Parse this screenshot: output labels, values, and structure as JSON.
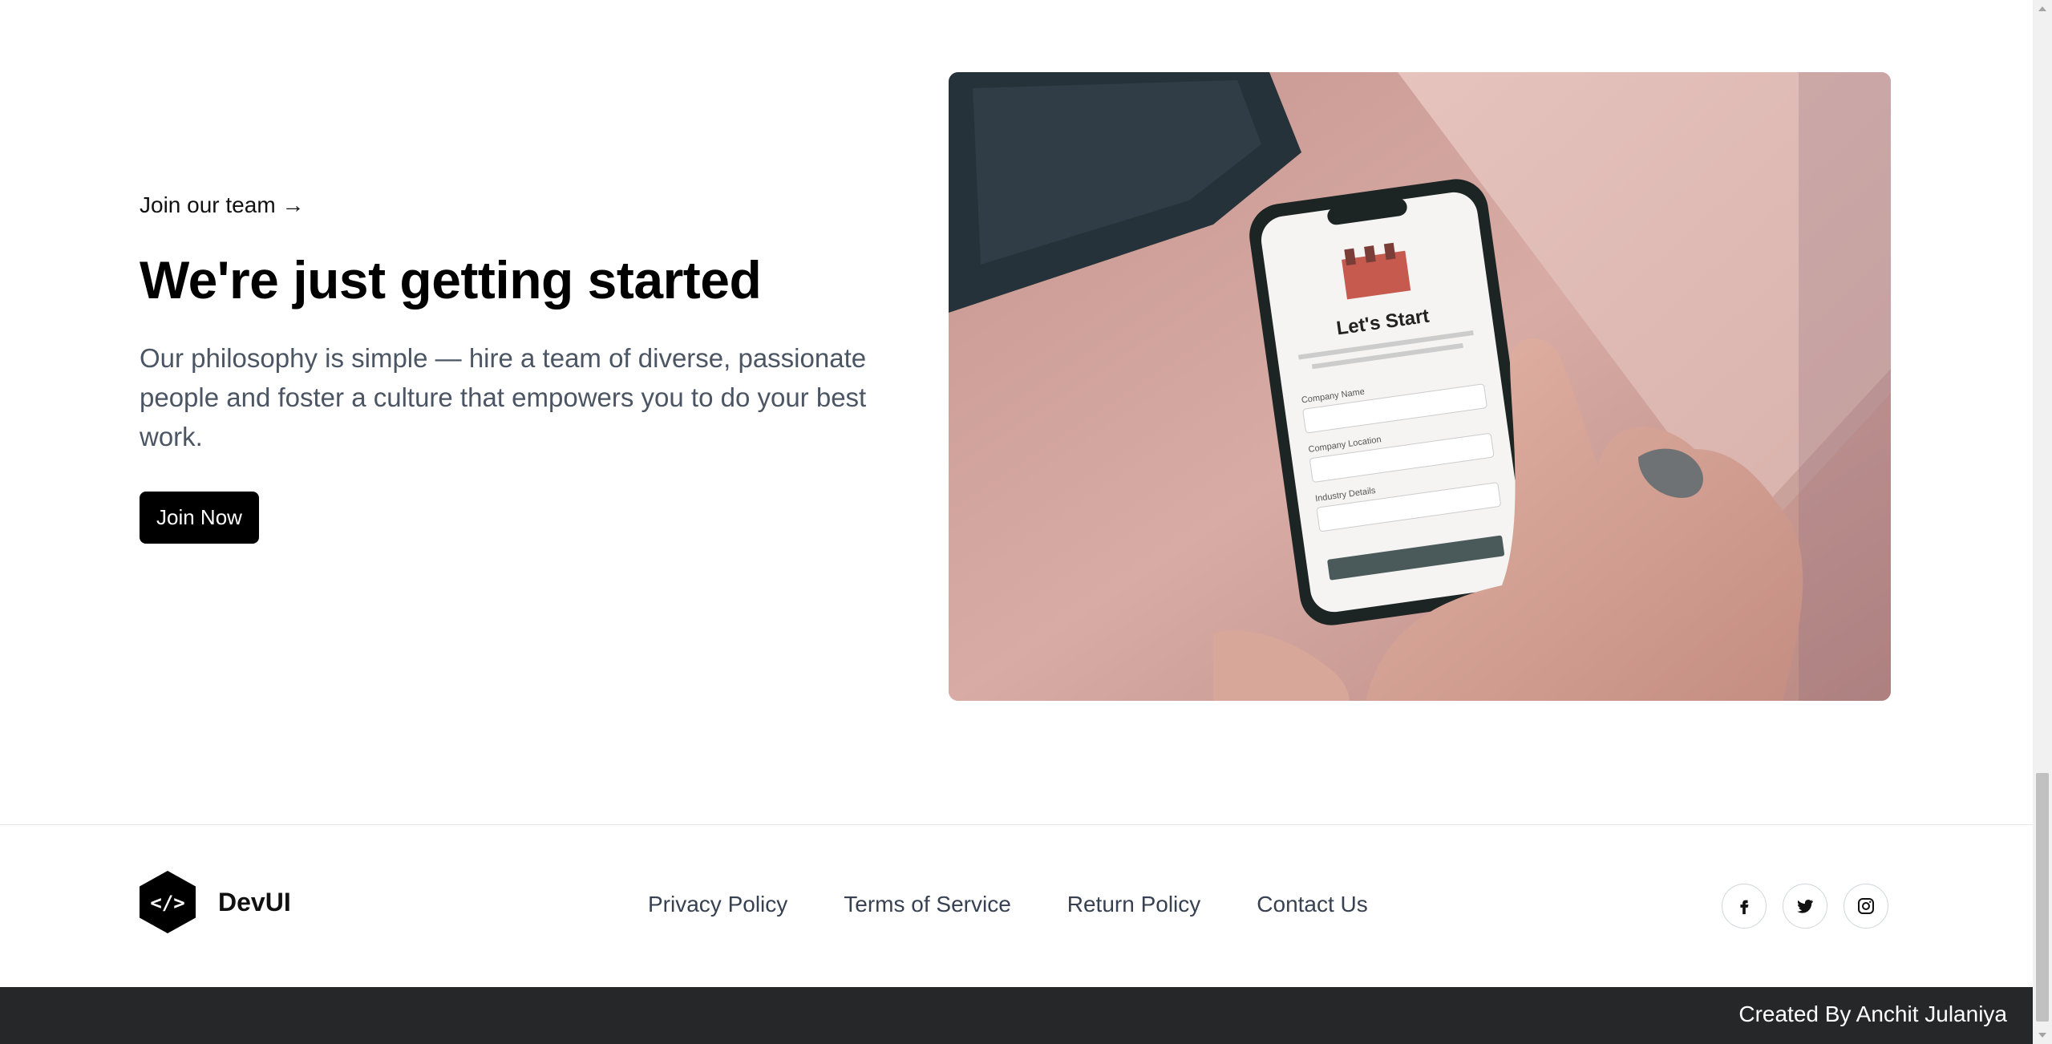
{
  "hero": {
    "eyebrow": "Join our team →",
    "headline": "We're just getting started",
    "subtext": "Our philosophy is simple — hire a team of diverse, passionate people and foster a culture that empowers you to do your best work.",
    "cta_label": "Join Now",
    "image": {
      "phone_screen_title": "Let's Start",
      "phone_field_1": "Company Name",
      "phone_field_2": "Company Location",
      "phone_field_3": "Industry Details"
    }
  },
  "footer": {
    "brand_name": "DevUI",
    "brand_logo_icon": "code-brackets-icon",
    "links": [
      {
        "label": "Privacy Policy"
      },
      {
        "label": "Terms of Service"
      },
      {
        "label": "Return Policy"
      },
      {
        "label": "Contact Us"
      }
    ],
    "socials": [
      {
        "icon": "facebook-icon"
      },
      {
        "icon": "twitter-icon"
      },
      {
        "icon": "instagram-icon"
      }
    ],
    "credit": "Created By Anchit Julaniya"
  },
  "colors": {
    "primary": "#000000",
    "bottom_bar": "#262729",
    "muted_text": "#4b5563",
    "link_text": "#374151"
  }
}
